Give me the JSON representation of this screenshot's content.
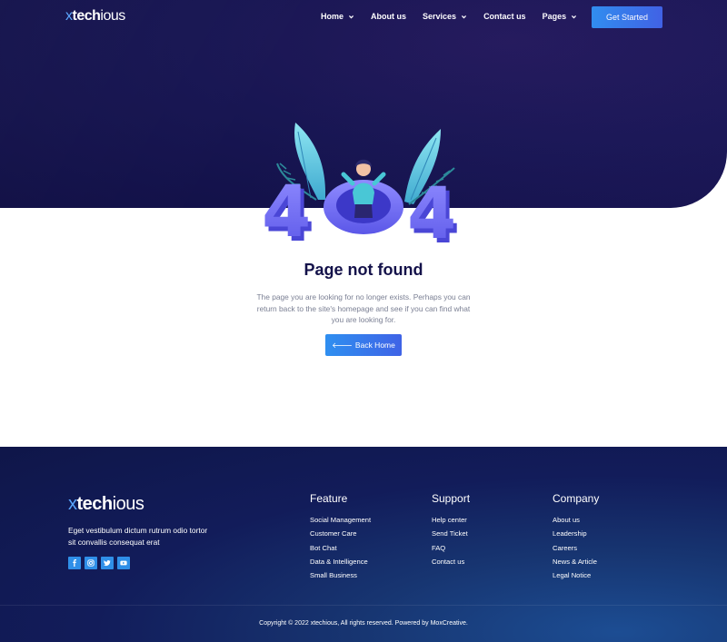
{
  "brand": {
    "prefix": "x",
    "bold": "tech",
    "rest": "ious"
  },
  "nav": {
    "items": [
      {
        "label": "Home",
        "dropdown": true
      },
      {
        "label": "About us",
        "dropdown": false
      },
      {
        "label": "Services",
        "dropdown": true
      },
      {
        "label": "Contact us",
        "dropdown": false
      },
      {
        "label": "Pages",
        "dropdown": true
      }
    ],
    "cta_label": "Get Started"
  },
  "error": {
    "code_left": "4",
    "code_right": "4",
    "title": "Page not found",
    "description": "The page you are looking for no longer exists. Perhaps you can return back to the site's homepage and see if you can find what you are looking for.",
    "back_label": "Back Home"
  },
  "footer": {
    "description": "Eget vestibulum dictum rutrum odio tortor sit convallis consequat erat",
    "socials": [
      "facebook-icon",
      "instagram-icon",
      "twitter-icon",
      "youtube-icon"
    ],
    "columns": [
      {
        "title": "Feature",
        "links": [
          "Social Management",
          "Customer Care",
          "Bot Chat",
          "Data & Intelligence",
          "Small Business"
        ]
      },
      {
        "title": "Support",
        "links": [
          "Help center",
          "Send Ticket",
          "FAQ",
          "Contact us"
        ]
      },
      {
        "title": "Company",
        "links": [
          "About us",
          "Leadership",
          "Careers",
          "News & Article",
          "Legal Notice"
        ]
      }
    ],
    "copyright": "Copyright © 2022 xtechious, All rights reserved. Powered by MoxCreative."
  },
  "colors": {
    "hero_bg": "#181653",
    "accent_start": "#2f8ff0",
    "accent_end": "#3f63e6",
    "title": "#14124a",
    "logo_x": "#5aa6ff"
  }
}
